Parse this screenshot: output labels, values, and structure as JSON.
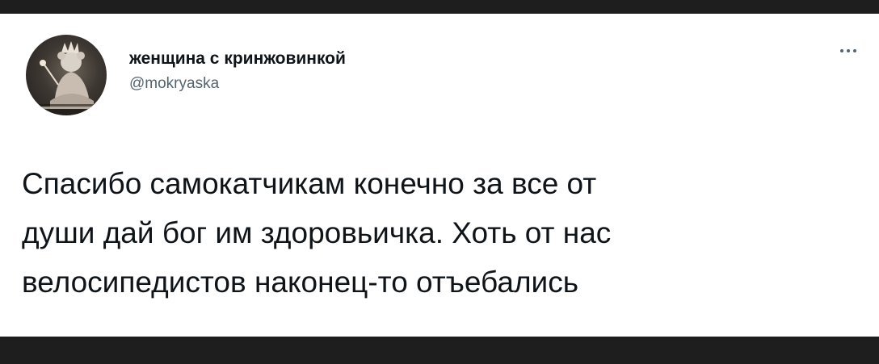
{
  "tweet": {
    "author": {
      "display_name": "женщина с кринжовинкой",
      "handle": "@mokryaska",
      "avatar_icon": "avatar-photo-mouse-with-crown"
    },
    "more_icon": "more-horizontal-icon",
    "text_lines": [
      "Спасибо самокатчикам конечно за все от",
      "души дай бог им здоровьичка. Хоть от нас",
      "велосипедистов наконец-то отъебались"
    ]
  },
  "colors": {
    "frame": "#1e1e1e",
    "card": "#ffffff",
    "text_primary": "#0f1419",
    "text_secondary": "#536471"
  }
}
